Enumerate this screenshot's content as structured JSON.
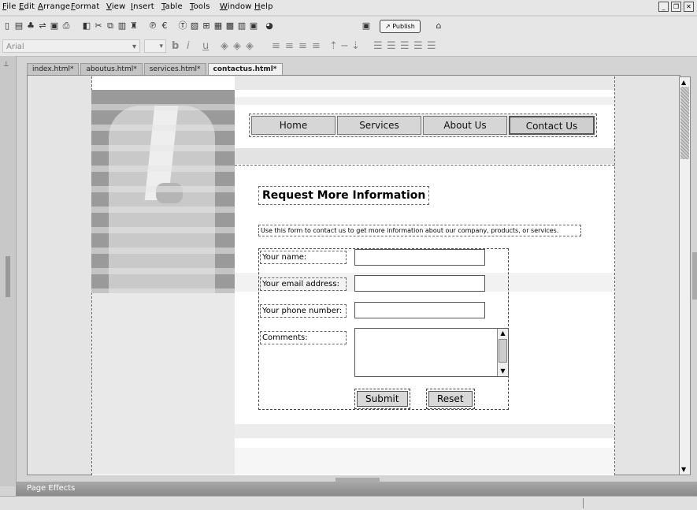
{
  "menu": [
    "File",
    "Edit",
    "Arrange",
    "Format",
    "View",
    "Insert",
    "Table",
    "Tools",
    "Window",
    "Help"
  ],
  "toolbar": {
    "publish_label": "Publish"
  },
  "format_bar": {
    "font": "Arial",
    "bold": "b",
    "italic": "i",
    "underline": "u"
  },
  "tabs": [
    "index.html*",
    "aboutus.html*",
    "services.html*",
    "contactus.html*"
  ],
  "active_tab": "contactus.html*",
  "nav": [
    "Home",
    "Services",
    "About Us",
    "Contact Us"
  ],
  "heading": "Request More Information",
  "intro": "Use this form to contact us to get more information about our company, products, or services.",
  "form": {
    "name_label": "Your name:",
    "email_label": "Your email address:",
    "phone_label": "Your phone number:",
    "comments_label": "Comments:",
    "submit": "Submit",
    "reset": "Reset"
  },
  "panel": {
    "title": "Page Effects"
  }
}
